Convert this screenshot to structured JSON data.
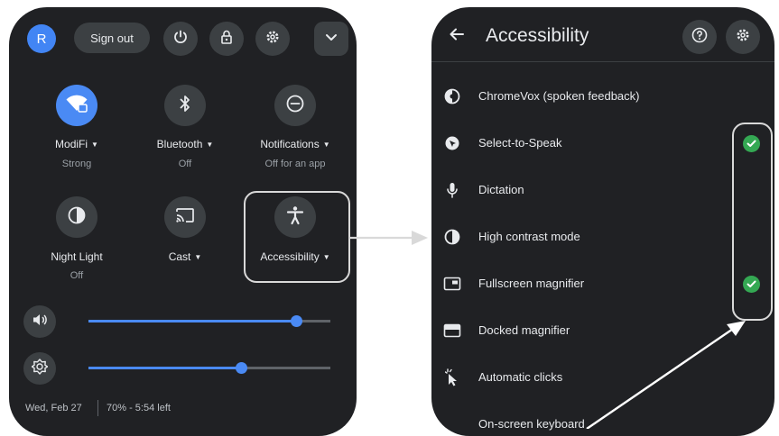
{
  "quick_settings": {
    "avatar_initial": "R",
    "sign_out_label": "Sign out",
    "tiles": [
      {
        "label": "ModiFi",
        "sub": "Strong",
        "has_caret": true,
        "icon": "wifi-icon"
      },
      {
        "label": "Bluetooth",
        "sub": "Off",
        "has_caret": true,
        "icon": "bluetooth-icon"
      },
      {
        "label": "Notifications",
        "sub": "Off for an app",
        "has_caret": true,
        "icon": "do-not-disturb-icon"
      },
      {
        "label": "Night Light",
        "sub": "Off",
        "has_caret": false,
        "icon": "night-light-icon"
      },
      {
        "label": "Cast",
        "sub": "",
        "has_caret": true,
        "icon": "cast-icon"
      },
      {
        "label": "Accessibility",
        "sub": "",
        "has_caret": true,
        "icon": "accessibility-icon"
      }
    ],
    "volume_level": 0.86,
    "brightness_level": 0.63,
    "footer": {
      "date": "Wed, Feb 27",
      "battery": "70% - 5:54 left"
    }
  },
  "accessibility": {
    "title": "Accessibility",
    "items": [
      {
        "label": "ChromeVox (spoken feedback)",
        "icon": "chromevox-icon",
        "checked": false
      },
      {
        "label": "Select-to-Speak",
        "icon": "select-to-speak-icon",
        "checked": true
      },
      {
        "label": "Dictation",
        "icon": "microphone-icon",
        "checked": false
      },
      {
        "label": "High contrast mode",
        "icon": "contrast-icon",
        "checked": false
      },
      {
        "label": "Fullscreen magnifier",
        "icon": "fullscreen-magnifier-icon",
        "checked": true
      },
      {
        "label": "Docked magnifier",
        "icon": "docked-magnifier-icon",
        "checked": false
      },
      {
        "label": "Automatic clicks",
        "icon": "automatic-clicks-icon",
        "checked": false
      },
      {
        "label": "On-screen keyboard",
        "icon": "keyboard-icon",
        "checked": false
      }
    ]
  },
  "colors": {
    "panel": "#202124",
    "accent": "#4a8af4",
    "check": "#34a853",
    "highlight": "#d9d9d9"
  }
}
